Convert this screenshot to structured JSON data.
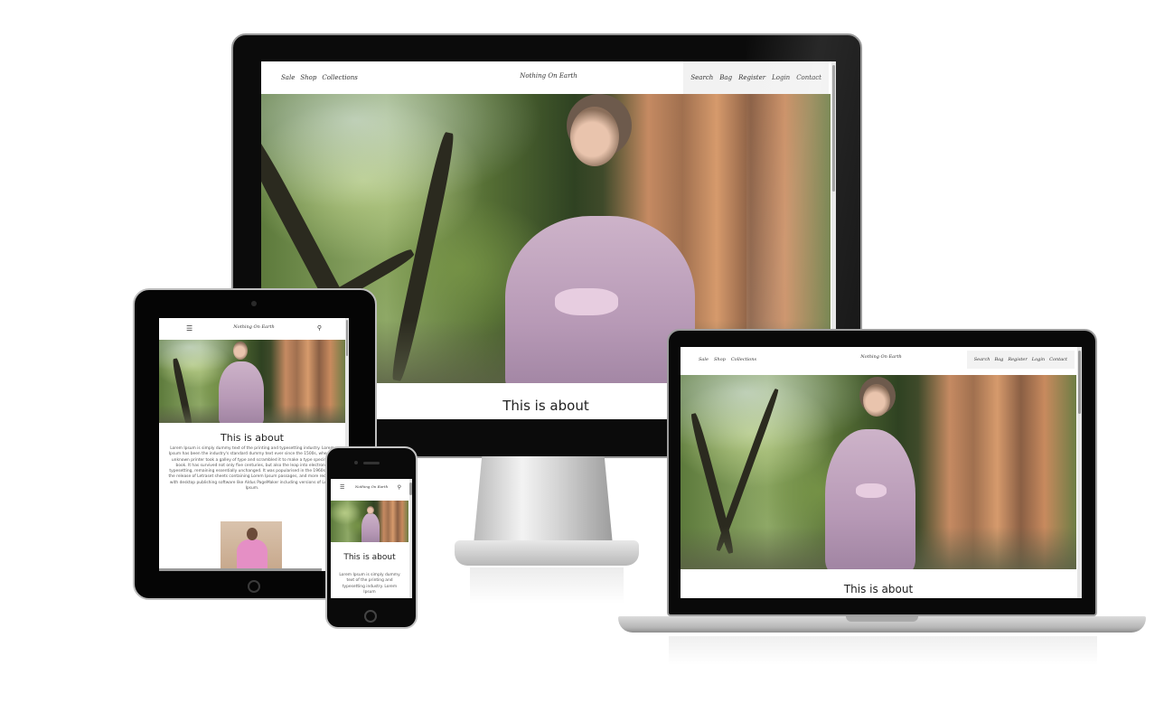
{
  "site": {
    "brand": "Nothing On Earth",
    "nav_left": [
      "Sale",
      "Shop",
      "Collections"
    ],
    "nav_right": [
      "Search",
      "Bag",
      "Register",
      "Login",
      "Contact"
    ],
    "menu_icon": "hamburger-icon",
    "search_icon": "search-icon"
  },
  "section": {
    "heading": "This is about",
    "tablet_paragraph": "Lorem Ipsum is simply dummy text of the printing and typesetting industry. Lorem Ipsum has been the industry's standard dummy text ever since the 1500s, when an unknown printer took a galley of type and scrambled it to make a type specimen book. It has survived not only five centuries, but also the leap into electronic typesetting, remaining essentially unchanged. It was popularised in the 1960s with the release of Letraset sheets containing Lorem Ipsum passages, and more recently with desktop publishing software like Aldus PageMaker including versions of Lorem Ipsum.",
    "phone_paragraph": "Lorem Ipsum is simply dummy text of the printing and typesetting industry. Lorem Ipsum"
  },
  "colors": {
    "device_bezel": "#0b0b0b",
    "nav_highlight": "#f2f2f2",
    "dress_pink": "#e58fc5"
  }
}
